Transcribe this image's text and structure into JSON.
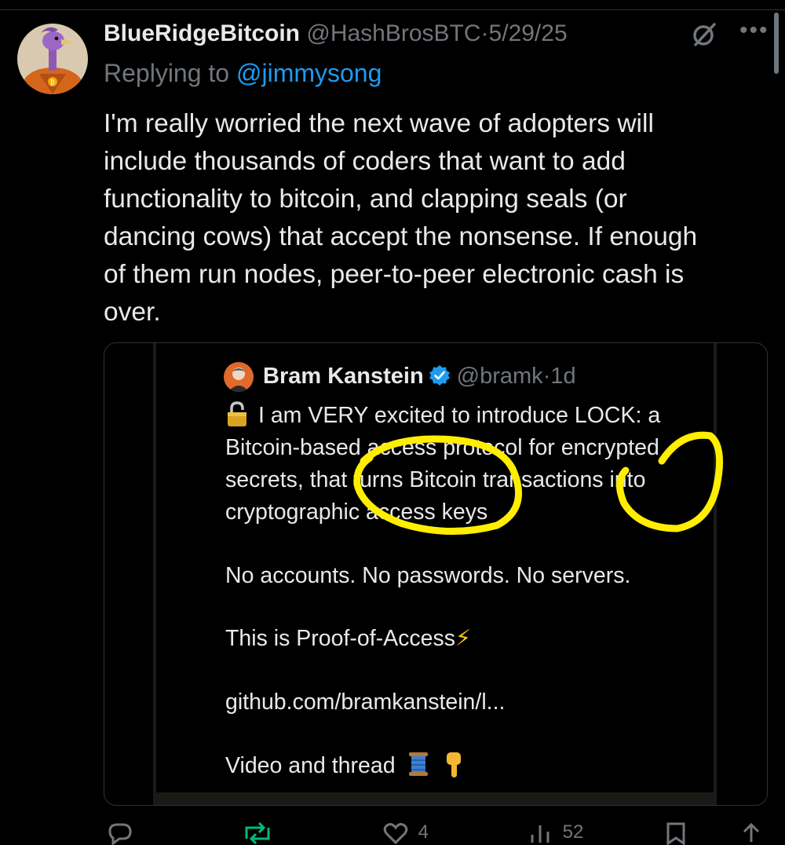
{
  "tweet": {
    "display_name": "BlueRidgeBitcoin",
    "handle": "@HashBrosBTC",
    "separator": "·",
    "date": "5/29/25",
    "reply_prefix": "Replying to",
    "reply_mention": "@jimmysong",
    "text": "I'm really worried the next wave of adopters will\ninclude thousands of coders that want to add\nfunctionality to bitcoin, and clapping seals (or\ndancing cows) that accept the nonsense. If enough\nof them run nodes, peer-to-peer electronic cash is\nover.",
    "more_label": "•••",
    "icons": {
      "grok": "grok-icon",
      "more": "more-icon"
    }
  },
  "quote": {
    "display_name": "Bram Kanstein",
    "handle": "@bramk",
    "separator": "·",
    "time": "1d",
    "text_main": "I am VERY excited to introduce LOCK: a\nBitcoin-based access protocol for encrypted\nsecrets, that turns Bitcoin transactions into\ncryptographic access keys",
    "line_no_accounts": "No accounts. No passwords. No servers.",
    "line_poa": "This is Proof-of-Access",
    "line_link": "github.com/bramkanstein/l...",
    "line_video": "Video and thread",
    "emoji": {
      "lock": "lock-icon",
      "bolt": "⚡",
      "spool": "🧵",
      "point": "👇"
    },
    "highlight_color": "#ffee00"
  },
  "actions": {
    "reply": {
      "icon": "reply-icon"
    },
    "repost": {
      "icon": "repost-icon"
    },
    "like": {
      "icon": "heart-icon",
      "count": "4"
    },
    "views": {
      "icon": "views-icon",
      "count": "52"
    },
    "bookmark": {
      "icon": "bookmark-icon"
    },
    "share": {
      "icon": "share-icon"
    }
  },
  "colors": {
    "accent": "#1d9bf0",
    "muted": "#71767b",
    "text": "#e7e9ea",
    "repost": "#00ba7c"
  }
}
